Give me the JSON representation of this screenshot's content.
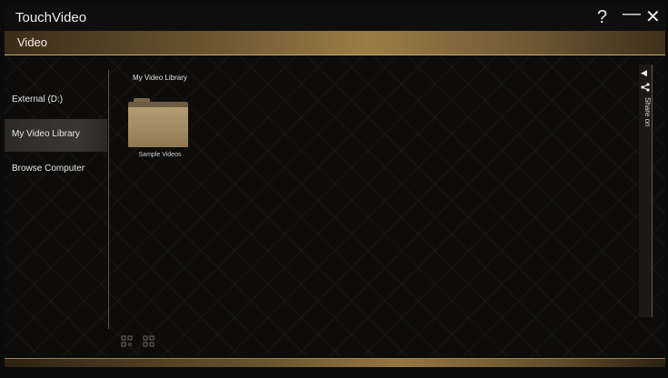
{
  "app": {
    "title": "TouchVideo"
  },
  "window_controls": {
    "help": "?",
    "minimize": "—",
    "close": "✕"
  },
  "header": {
    "title": "Video"
  },
  "sidebar": {
    "items": [
      {
        "label": "External (D:)",
        "active": false
      },
      {
        "label": "My Video Library",
        "active": true
      },
      {
        "label": "Browse Computer",
        "active": false
      }
    ]
  },
  "content": {
    "breadcrumb": "My Video Library",
    "folders": [
      {
        "label": "Sample Videos"
      }
    ]
  },
  "share_panel": {
    "label": "Share on",
    "arrow": "◀"
  },
  "colors": {
    "accent_gold": "#9b7d47",
    "background": "#0b0b0b",
    "folder": "#a18a62"
  }
}
